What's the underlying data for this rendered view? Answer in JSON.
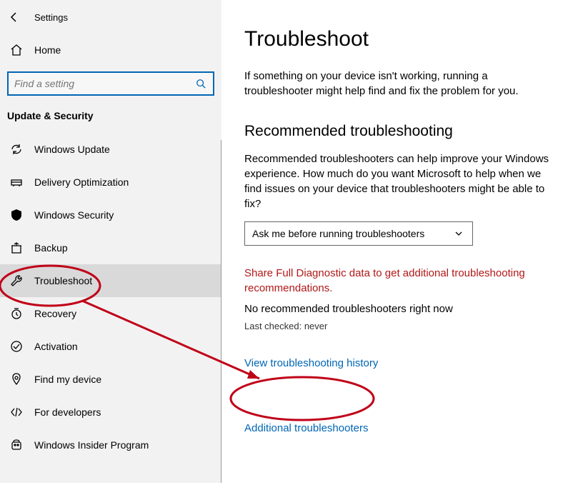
{
  "window_title": "Settings",
  "home_label": "Home",
  "search": {
    "placeholder": "Find a setting"
  },
  "category_title": "Update & Security",
  "nav": [
    {
      "label": "Windows Update"
    },
    {
      "label": "Delivery Optimization"
    },
    {
      "label": "Windows Security"
    },
    {
      "label": "Backup"
    },
    {
      "label": "Troubleshoot"
    },
    {
      "label": "Recovery"
    },
    {
      "label": "Activation"
    },
    {
      "label": "Find my device"
    },
    {
      "label": "For developers"
    },
    {
      "label": "Windows Insider Program"
    }
  ],
  "main": {
    "title": "Troubleshoot",
    "intro": "If something on your device isn't working, running a troubleshooter might help find and fix the problem for you.",
    "section_title": "Recommended troubleshooting",
    "rec_text": "Recommended troubleshooters can help improve your Windows experience. How much do you want Microsoft to help when we find issues on your device that troubleshooters might be able to fix?",
    "dropdown_value": "Ask me before running troubleshooters",
    "diag_warning": "Share Full Diagnostic data to get additional troubleshooting recommendations.",
    "none_text": "No recommended troubleshooters right now",
    "last_checked": "Last checked: never",
    "history_link": "View troubleshooting history",
    "additional_link": "Additional troubleshooters"
  }
}
